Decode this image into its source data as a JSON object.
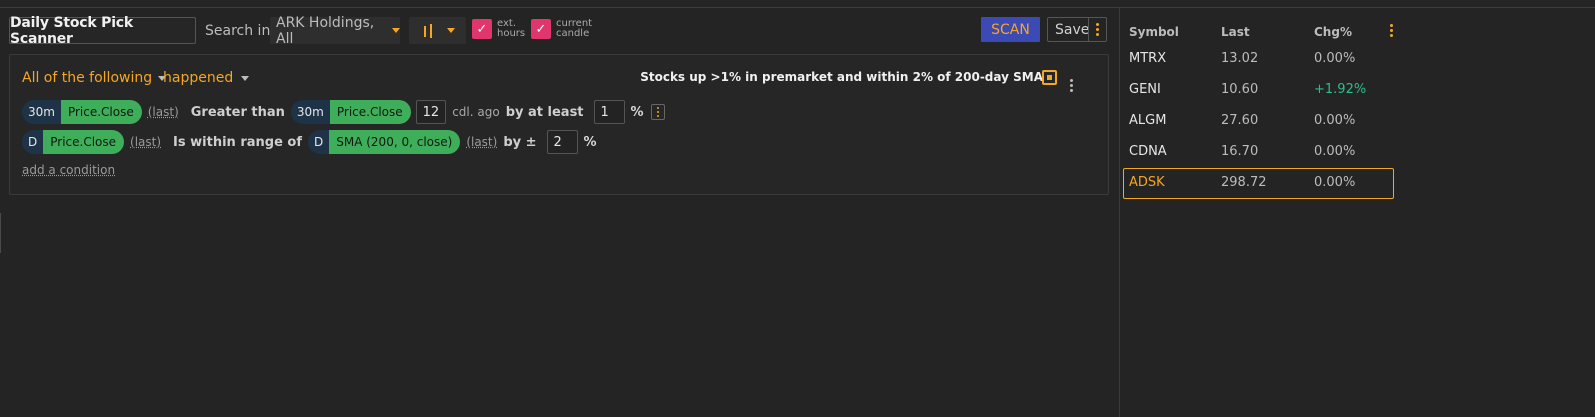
{
  "toolbar": {
    "title": "Daily Stock Pick Scanner",
    "search_in_label": "Search in",
    "universe_value": "ARK Holdings, All",
    "ext_hours_label": "ext. hours",
    "current_candle_label": "current candle",
    "scan_label": "SCAN",
    "save_label": "Save"
  },
  "panel": {
    "logic": "All of the following",
    "happened": "happened",
    "description": "Stocks up >1% in premarket and within 2% of 200-day SMA",
    "add_condition": "add a condition"
  },
  "conditions": [
    {
      "timeframe": "30m",
      "field": "Price.Close",
      "qualifier": "(last)",
      "operator": "Greater than",
      "timeframe2": "30m",
      "field2": "Price.Close",
      "bars": "12",
      "bars_label": "cdl. ago",
      "by_label": "by at least",
      "amount": "1",
      "unit": "%"
    },
    {
      "timeframe": "D",
      "field": "Price.Close",
      "qualifier": "(last)",
      "operator": "Is within range of",
      "timeframe2": "D",
      "field2": "SMA (200, 0, close)",
      "qualifier2": "(last)",
      "by_label": "by ±",
      "amount": "2",
      "unit": "%"
    }
  ],
  "watchlist": {
    "headers": [
      "Symbol",
      "Last",
      "Chg%"
    ],
    "rows": [
      {
        "symbol": "MTRX",
        "last": "13.02",
        "chg": "0.00%"
      },
      {
        "symbol": "GENI",
        "last": "10.60",
        "chg": "+1.92%"
      },
      {
        "symbol": "ALGM",
        "last": "27.60",
        "chg": "0.00%"
      },
      {
        "symbol": "CDNA",
        "last": "16.70",
        "chg": "0.00%"
      },
      {
        "symbol": "ADSK",
        "last": "298.72",
        "chg": "0.00%"
      }
    ],
    "selected_symbol": "ADSK"
  },
  "colors": {
    "background": "#242424",
    "accent": "#f5a623",
    "scan_button": "#3b4ab5",
    "checkbox": "#e0356d",
    "field_pill": "#3fae5a",
    "timeframe_pill": "#1e3347",
    "positive": "#2bbf8a"
  }
}
